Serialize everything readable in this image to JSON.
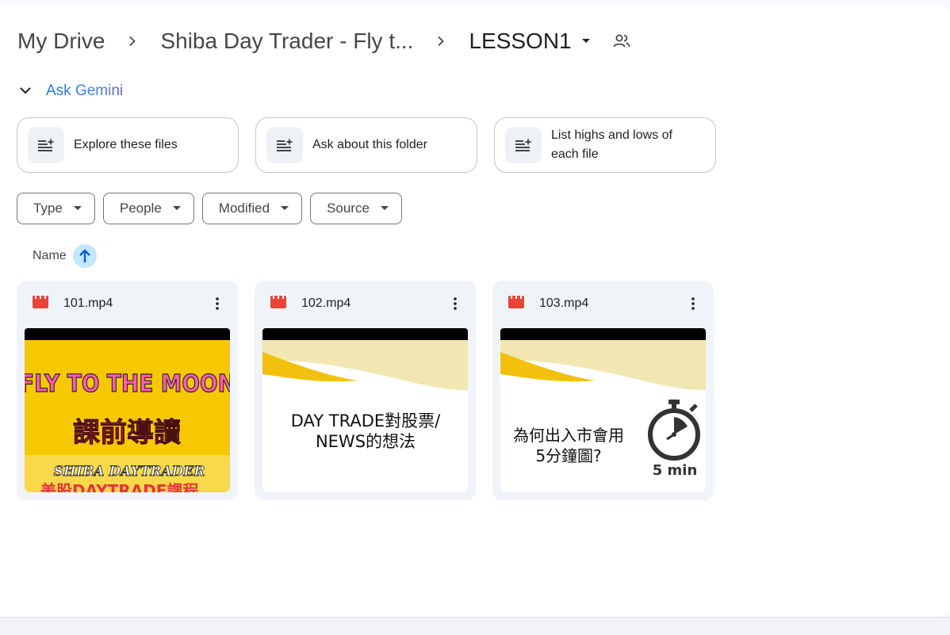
{
  "breadcrumb": {
    "root": "My Drive",
    "parent": "Shiba Day Trader - Fly t...",
    "current": "LESSON1"
  },
  "gemini": {
    "label": "Ask Gemini",
    "chips": [
      {
        "label": "Explore these files"
      },
      {
        "label": "Ask about this folder"
      },
      {
        "label": "List highs and lows of each file"
      }
    ]
  },
  "filters": [
    {
      "label": "Type"
    },
    {
      "label": "People"
    },
    {
      "label": "Modified"
    },
    {
      "label": "Source"
    }
  ],
  "sort": {
    "label": "Name",
    "direction": "ascending"
  },
  "files": [
    {
      "name": "101.mp4",
      "thumb": {
        "line1": "FLY TO THE MOON",
        "line2": "課前導讀",
        "line3": "SHIBA DAYTRADER",
        "line4": "美股DAYTRADE課程"
      }
    },
    {
      "name": "102.mp4",
      "thumb": {
        "line1": "DAY TRADE對股票/",
        "line2": "NEWS的想法"
      }
    },
    {
      "name": "103.mp4",
      "thumb": {
        "line1": "為何出入市會用",
        "line2": "5分鐘圖?",
        "badge": "5 min"
      }
    }
  ],
  "colors": {
    "accent": "#0b57d0",
    "video_icon": "#ea4335",
    "sort_bg": "#c2e7ff",
    "thumb_yellow": "#f5c518"
  },
  "icons": {
    "breadcrumb_separator": "chevron-right-icon",
    "crumb_dropdown": "caret-down-icon",
    "shared": "people-icon",
    "gemini_toggle": "chevron-down-icon",
    "chip": "sparkle-list-icon",
    "filter_dropdown": "caret-down-icon",
    "sort": "arrow-up-icon",
    "file": "video-file-icon",
    "more": "more-vert-icon"
  }
}
